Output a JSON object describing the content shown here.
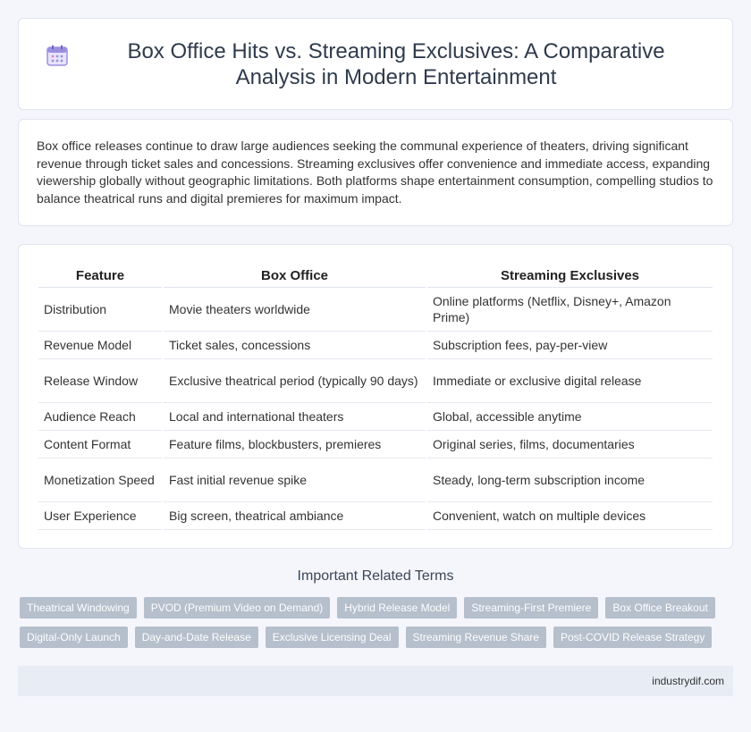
{
  "header": {
    "title": "Box Office Hits vs. Streaming Exclusives: A Comparative Analysis in Modern Entertainment",
    "icon": "calendar-icon"
  },
  "intro": {
    "text": "Box office releases continue to draw large audiences seeking the communal experience of theaters, driving significant revenue through ticket sales and concessions. Streaming exclusives offer convenience and immediate access, expanding viewership globally without geographic limitations. Both platforms shape entertainment consumption, compelling studios to balance theatrical runs and digital premieres for maximum impact."
  },
  "table": {
    "headers": [
      "Feature",
      "Box Office",
      "Streaming Exclusives"
    ],
    "rows": [
      [
        "Distribution",
        "Movie theaters worldwide",
        "Online platforms (Netflix, Disney+, Amazon Prime)"
      ],
      [
        "Revenue Model",
        "Ticket sales, concessions",
        "Subscription fees, pay-per-view"
      ],
      [
        "Release Window",
        "Exclusive theatrical period (typically 90 days)",
        "Immediate or exclusive digital release"
      ],
      [
        "Audience Reach",
        "Local and international theaters",
        "Global, accessible anytime"
      ],
      [
        "Content Format",
        "Feature films, blockbusters, premieres",
        "Original series, films, documentaries"
      ],
      [
        "Monetization Speed",
        "Fast initial revenue spike",
        "Steady, long-term subscription income"
      ],
      [
        "User Experience",
        "Big screen, theatrical ambiance",
        "Convenient, watch on multiple devices"
      ]
    ]
  },
  "related": {
    "title": "Important Related Terms",
    "tags": [
      "Theatrical Windowing",
      "PVOD (Premium Video on Demand)",
      "Hybrid Release Model",
      "Streaming-First Premiere",
      "Box Office Breakout",
      "Digital-Only Launch",
      "Day-and-Date Release",
      "Exclusive Licensing Deal",
      "Streaming Revenue Share",
      "Post-COVID Release Strategy"
    ]
  },
  "footer": {
    "site": "industrydif.com"
  },
  "colors": {
    "accent": "#b6bfcc",
    "icon": "#8b7fd6",
    "background": "#f4f6fb"
  }
}
